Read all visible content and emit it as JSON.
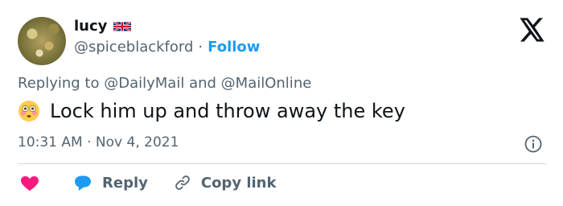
{
  "author": {
    "name": "lucy",
    "handle": "@spiceblackford",
    "separator": "·",
    "follow_label": "Follow"
  },
  "reply_context": {
    "prefix": "Replying to",
    "mention1": "@DailyMail",
    "conjunction": "and",
    "mention2": "@MailOnline"
  },
  "tweet": {
    "emoji": "flushed-face",
    "text": "Lock him up and throw away the key"
  },
  "meta": {
    "time": "10:31 AM",
    "separator": "·",
    "date": "Nov 4, 2021"
  },
  "actions": {
    "reply_label": "Reply",
    "copy_link_label": "Copy link"
  },
  "colors": {
    "accent": "#1d9bf0",
    "like": "#f91880",
    "muted": "#536471"
  }
}
